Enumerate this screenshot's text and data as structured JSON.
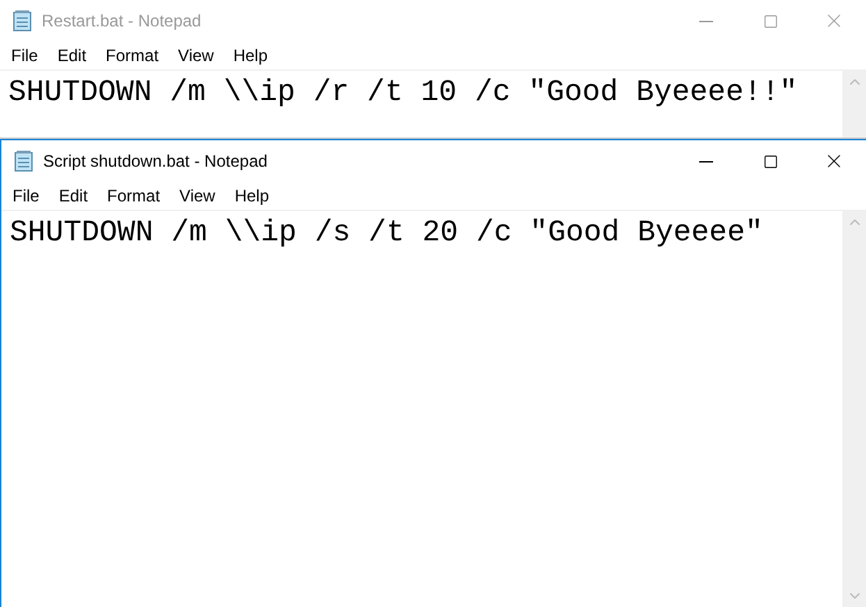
{
  "windows": [
    {
      "title": "Restart.bat - Notepad",
      "active": false,
      "menu": [
        "File",
        "Edit",
        "Format",
        "View",
        "Help"
      ],
      "text": "SHUTDOWN /m \\\\ip /r /t 10 /c \"Good Byeeee!!\""
    },
    {
      "title": "Script shutdown.bat - Notepad",
      "active": true,
      "menu": [
        "File",
        "Edit",
        "Format",
        "View",
        "Help"
      ],
      "text": "SHUTDOWN /m \\\\ip /s /t 20 /c \"Good Byeeee\""
    }
  ]
}
